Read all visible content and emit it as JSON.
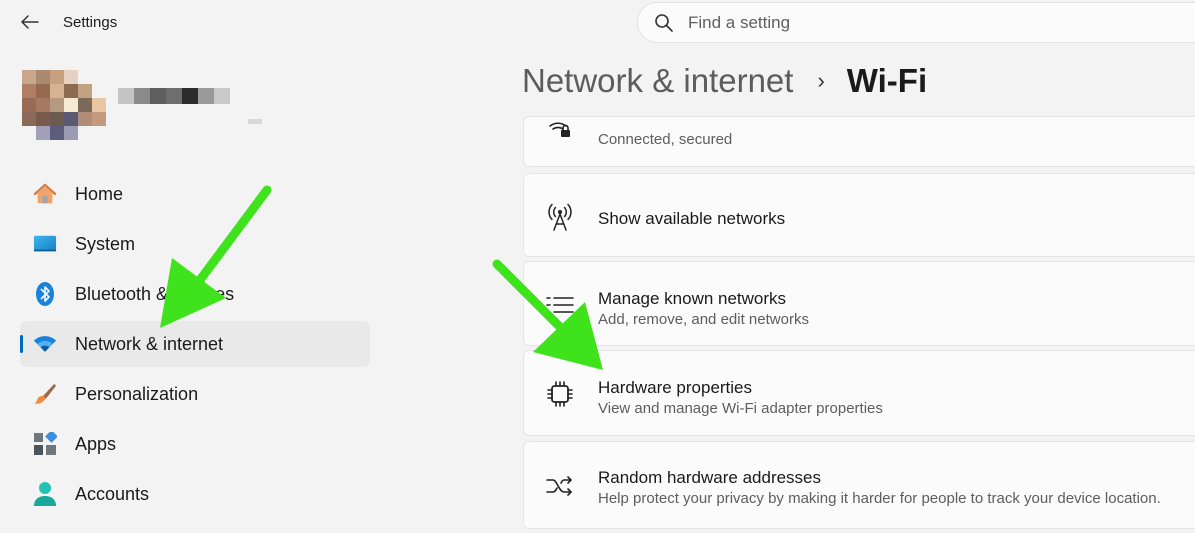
{
  "window": {
    "title": "Settings"
  },
  "search": {
    "placeholder": "Find a setting"
  },
  "nav": {
    "items": [
      {
        "label": "Home",
        "icon": "home-icon"
      },
      {
        "label": "System",
        "icon": "system-icon"
      },
      {
        "label": "Bluetooth & devices",
        "icon": "bluetooth-icon"
      },
      {
        "label": "Network & internet",
        "icon": "wifi-icon",
        "selected": true
      },
      {
        "label": "Personalization",
        "icon": "brush-icon"
      },
      {
        "label": "Apps",
        "icon": "apps-icon"
      },
      {
        "label": "Accounts",
        "icon": "accounts-icon"
      }
    ]
  },
  "breadcrumb": {
    "parent": "Network & internet",
    "separator": "›",
    "current": "Wi-Fi"
  },
  "cards": [
    {
      "title": "",
      "subtitle": "Connected, secured",
      "icon": "wifi-lock-icon"
    },
    {
      "title": "Show available networks",
      "subtitle": "",
      "icon": "antenna-icon"
    },
    {
      "title": "Manage known networks",
      "subtitle": "Add, remove, and edit networks",
      "icon": "list-icon"
    },
    {
      "title": "Hardware properties",
      "subtitle": "View and manage Wi-Fi adapter properties",
      "icon": "chip-icon"
    },
    {
      "title": "Random hardware addresses",
      "subtitle": "Help protect your privacy by making it harder for people to track your device location.",
      "icon": "shuffle-icon"
    }
  ],
  "colors": {
    "accent": "#0067c0",
    "annotation_arrow": "#3ee31b",
    "background": "#f3f3f3"
  }
}
